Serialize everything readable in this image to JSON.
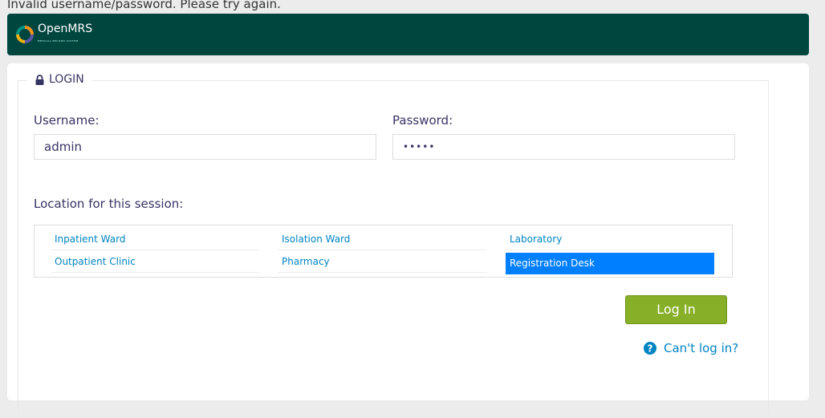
{
  "error": {
    "message": "Invalid username/password. Please try again."
  },
  "header": {
    "logo_text": "OpenMRS",
    "logo_subtext": "MEDICAL RECORD SYSTEM"
  },
  "login": {
    "legend": "LOGIN",
    "username_label": "Username:",
    "username_value": "admin",
    "password_label": "Password:",
    "password_value": "•••••",
    "location_label": "Location for this session:",
    "locations": [
      {
        "label": "Inpatient Ward",
        "selected": false
      },
      {
        "label": "Isolation Ward",
        "selected": false
      },
      {
        "label": "Laboratory",
        "selected": false
      },
      {
        "label": "Outpatient Clinic",
        "selected": false
      },
      {
        "label": "Pharmacy",
        "selected": false
      },
      {
        "label": "Registration Desk",
        "selected": true
      }
    ],
    "login_button": "Log In",
    "cant_login": "Can't log in?"
  },
  "colors": {
    "header": "#00463f",
    "button": "#88af28",
    "link": "#0084c2",
    "selected": "#007fff"
  },
  "icons": {
    "legend": "lock-icon",
    "help": "question-circle-icon"
  }
}
